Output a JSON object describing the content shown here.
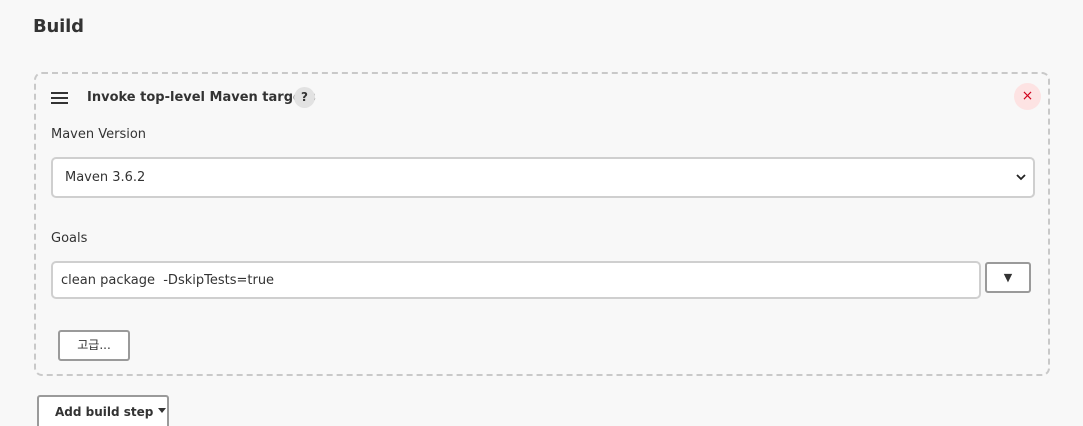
{
  "section": {
    "title": "Build"
  },
  "step": {
    "title": "Invoke top-level Maven targets",
    "help_icon": "?",
    "close_icon": "×"
  },
  "maven_version": {
    "label": "Maven Version",
    "selected": "Maven 3.6.2"
  },
  "goals": {
    "label": "Goals",
    "value": "clean package  -DskipTests=true",
    "expand_icon": "▼"
  },
  "advanced_button": {
    "label": "고급..."
  },
  "add_build_step": {
    "label": "Add build step"
  },
  "colors": {
    "background": "#f8f8f8",
    "close_icon": "#d0021b",
    "close_bg": "#fde3e3"
  },
  "icons": {
    "drag": "drag-handle-icon",
    "help": "help-icon",
    "close": "close-icon",
    "select_chevron": "chevron-down-icon",
    "expand": "expand-icon",
    "dropdown_caret": "caret-down-icon"
  }
}
